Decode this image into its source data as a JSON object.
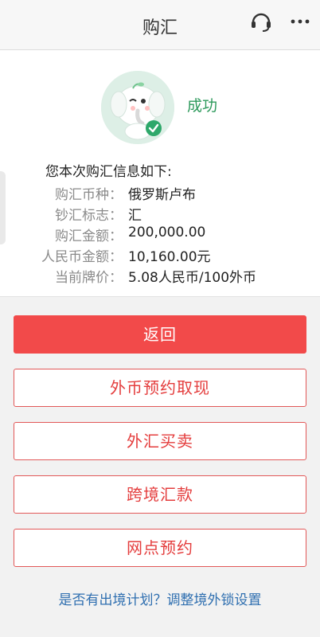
{
  "header": {
    "title": "购汇",
    "support_icon": "headset-icon",
    "more_icon": "more-dots-icon"
  },
  "result": {
    "status": "成功",
    "status_color": "#2e9a5c",
    "heading": "您本次购汇信息如下:",
    "rows": [
      {
        "label": "购汇币种：",
        "value": "俄罗斯卢布"
      },
      {
        "label": "钞汇标志：",
        "value": "汇"
      },
      {
        "label": "购汇金额：",
        "value": "200,000.00"
      },
      {
        "label": "人民币金额：",
        "value": "10,160.00元"
      },
      {
        "label": "当前牌价：",
        "value": "5.08人民币/100外币"
      }
    ]
  },
  "actions": {
    "back": "返回",
    "fx_reservation": "外币预约取现",
    "fx_trade": "外汇买卖",
    "cross_border": "跨境汇款",
    "branch_booking": "网点预约"
  },
  "footer": {
    "link": "是否有出境计划？调整境外锁设置"
  },
  "colors": {
    "accent_red": "#f24a4a",
    "link_blue": "#2f6fb0"
  }
}
